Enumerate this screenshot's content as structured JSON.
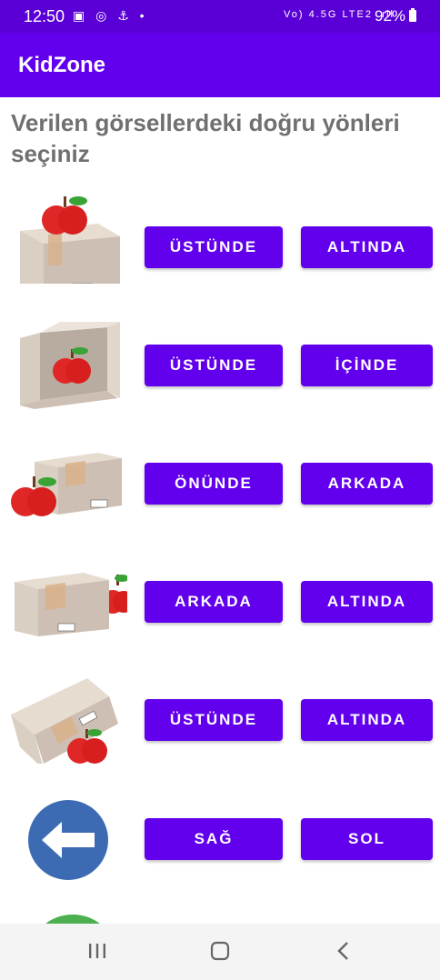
{
  "status": {
    "time": "12:50",
    "left_icons": "▣ ◎ ⚓ •",
    "network": "Vo) 4.5G LTE2 .ıll",
    "battery": "92%"
  },
  "app": {
    "title": "KidZone"
  },
  "question": "Verilen görsellerdeki doğru yönleri seçiniz",
  "rows": [
    {
      "image": "apple-on-box",
      "options": [
        "ÜSTÜNDE",
        "ALTINDA"
      ]
    },
    {
      "image": "apple-in-box",
      "options": [
        "ÜSTÜNDE",
        "İÇİNDE"
      ]
    },
    {
      "image": "apple-in-front-of-box",
      "options": [
        "ÖNÜNDE",
        "ARKADA"
      ]
    },
    {
      "image": "apple-behind-box",
      "options": [
        "ARKADA",
        "ALTINDA"
      ]
    },
    {
      "image": "apple-under-box",
      "options": [
        "ÜSTÜNDE",
        "ALTINDA"
      ]
    },
    {
      "image": "left-arrow-sign",
      "options": [
        "SAĞ",
        "SOL"
      ]
    }
  ],
  "colors": {
    "primary": "#6200ee",
    "status_bar": "#5a00d6",
    "question_text": "#707070",
    "arrow_sign": "#3d6bb3"
  },
  "nav": {
    "icons": [
      "recent-apps-icon",
      "home-icon",
      "back-icon"
    ]
  }
}
